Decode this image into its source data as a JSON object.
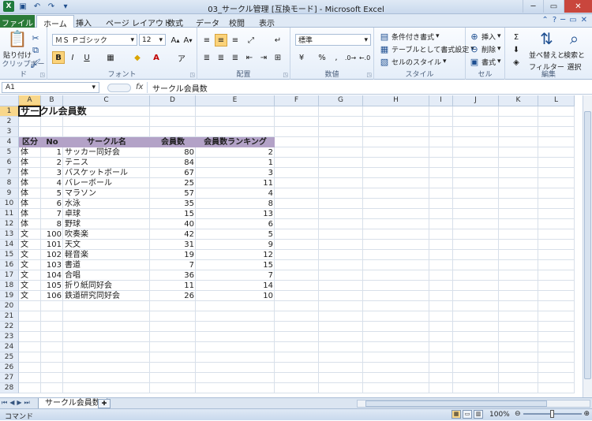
{
  "window": {
    "title": "03_サークル管理 [互換モード] - Microsoft Excel"
  },
  "titlebar": {
    "app_icon": "X",
    "minimize": "─",
    "maximize": "▭",
    "close": "✕"
  },
  "tabs": {
    "file": "ファイル",
    "home": "ホーム",
    "insert": "挿入",
    "page_layout": "ページ レイアウト",
    "formulas": "数式",
    "data": "データ",
    "review": "校閲",
    "view": "表示"
  },
  "ribbon": {
    "clipboard": {
      "label": "クリップボード",
      "paste": "貼り付け"
    },
    "font": {
      "label": "フォント",
      "name": "ＭＳ Ｐゴシック",
      "size": "12",
      "bold": "B",
      "italic": "I",
      "underline": "U"
    },
    "alignment": {
      "label": "配置"
    },
    "number": {
      "label": "数値",
      "format": "標準",
      "percent": "%",
      "comma": ","
    },
    "styles": {
      "label": "スタイル",
      "conditional": "条件付き書式",
      "table": "テーブルとして書式設定",
      "cell_styles": "セルのスタイル"
    },
    "cells": {
      "label": "セル",
      "insert": "挿入",
      "delete": "削除",
      "format": "書式"
    },
    "editing": {
      "label": "編集",
      "sort_filter": "並べ替えと",
      "sort_filter2": "フィルター",
      "find_select": "検索と",
      "find_select2": "選択"
    }
  },
  "formula_bar": {
    "name_box": "A1",
    "fx": "fx",
    "content": "サークル会員数"
  },
  "columns": [
    "A",
    "B",
    "C",
    "D",
    "E",
    "F",
    "G",
    "H",
    "I",
    "J",
    "K",
    "L"
  ],
  "sheet": {
    "title": "サークル会員数",
    "headers": [
      "区分",
      "No",
      "サークル名",
      "会員数",
      "会員数ランキング"
    ],
    "rows": [
      [
        "体",
        "1",
        "サッカー同好会",
        "80",
        "2"
      ],
      [
        "体",
        "2",
        "テニス",
        "84",
        "1"
      ],
      [
        "体",
        "3",
        "バスケットボール",
        "67",
        "3"
      ],
      [
        "体",
        "4",
        "バレーボール",
        "25",
        "11"
      ],
      [
        "体",
        "5",
        "マラソン",
        "57",
        "4"
      ],
      [
        "体",
        "6",
        "水泳",
        "35",
        "8"
      ],
      [
        "体",
        "7",
        "卓球",
        "15",
        "13"
      ],
      [
        "体",
        "8",
        "野球",
        "40",
        "6"
      ],
      [
        "文",
        "100",
        "吹奏楽",
        "42",
        "5"
      ],
      [
        "文",
        "101",
        "天文",
        "31",
        "9"
      ],
      [
        "文",
        "102",
        "軽音楽",
        "19",
        "12"
      ],
      [
        "文",
        "103",
        "書道",
        "7",
        "15"
      ],
      [
        "文",
        "104",
        "合唱",
        "36",
        "7"
      ],
      [
        "文",
        "105",
        "折り紙同好会",
        "11",
        "14"
      ],
      [
        "文",
        "106",
        "鉄道研究同好会",
        "26",
        "10"
      ]
    ]
  },
  "sheet_tabs": {
    "active": "サークル会員数"
  },
  "status": {
    "mode": "コマンド",
    "zoom": "100%"
  },
  "colors": {
    "header_fill": "#b3a2c7",
    "file_tab": "#2a7a38"
  }
}
